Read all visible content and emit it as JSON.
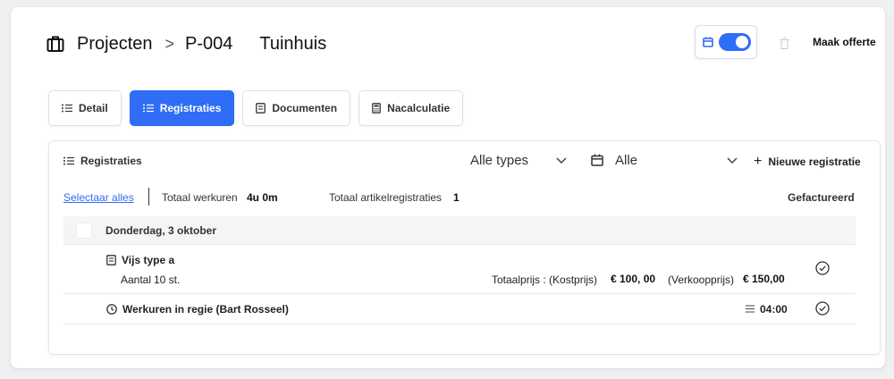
{
  "header": {
    "breadcrumb_root": "Projecten",
    "breadcrumb_sep": ">",
    "project_code": "P-004",
    "project_name": "Tuinhuis",
    "offerte_label": "Maak offerte"
  },
  "tabs": [
    {
      "label": "Detail",
      "active": false
    },
    {
      "label": "Registraties",
      "active": true
    },
    {
      "label": "Documenten",
      "active": false
    },
    {
      "label": "Nacalculatie",
      "active": false
    }
  ],
  "panel": {
    "title": "Registraties",
    "filter_types": "Alle types",
    "filter_date": "Alle",
    "new_registration": "Nieuwe registratie",
    "select_all": "Selectaar alles",
    "total_hours_label": "Totaal werkuren",
    "total_hours_value": "4u 0m",
    "total_articles_label": "Totaal artikelregistraties",
    "total_articles_value": "1",
    "invoiced_header": "Gefactureerd",
    "day_label": "Donderdag, 3 oktober",
    "items": [
      {
        "title": "Vijs type a",
        "qty_label": "Aantal",
        "qty_value": "10 st.",
        "price_label": "Totaalprijs : (Kostprijs)",
        "cost_value": "€ 100, 00",
        "sell_label": "(Verkoopprijs)",
        "sell_value": "€ 150,00"
      },
      {
        "title": "Werkuren in regie  (Bart Rosseel)",
        "hours": "04:00"
      }
    ]
  },
  "colors": {
    "accent": "#2f6df6",
    "background": "#eef0f2"
  }
}
